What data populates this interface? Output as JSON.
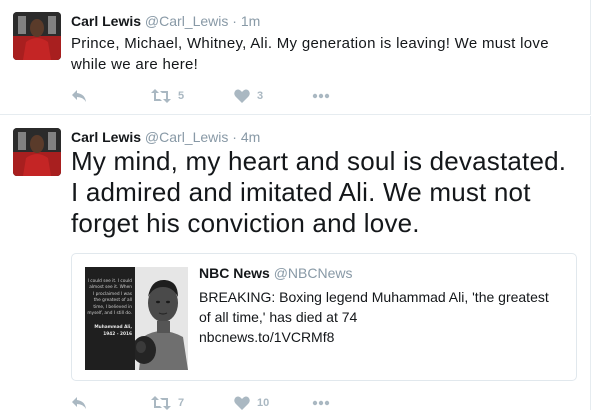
{
  "colors": {
    "text": "#14171a",
    "muted": "#8899a6",
    "action_icon": "#aab8c2",
    "border": "#e6ecf0"
  },
  "tweets": [
    {
      "author_name": "Carl Lewis",
      "author_handle": "@Carl_Lewis",
      "separator": "·",
      "time": "1m",
      "text": "Prince,  Michael,  Whitney, Ali.  My generation is leaving!  We must love while we are here!",
      "actions": {
        "reply_icon": "reply-icon",
        "retweet_icon": "retweet-icon",
        "retweet_count": "5",
        "like_icon": "heart-icon",
        "like_count": "3",
        "more_icon": "more-icon"
      }
    },
    {
      "author_name": "Carl Lewis",
      "author_handle": "@Carl_Lewis",
      "separator": "·",
      "time": "4m",
      "text": "My mind, my heart and soul is devastated. I admired and imitated Ali.  We must not forget his conviction and love.",
      "quoted": {
        "author_name": "NBC News",
        "author_handle": "@NBCNews",
        "text": "BREAKING: Boxing legend Muhammad Ali, 'the greatest of all time,' has died at 74",
        "link": "nbcnews.to/1VCRMf8",
        "image_quote": "I could see it. I could almost see it. When I proclaimed I was the greatest of all time, I believed in myself, and I still do.",
        "image_credit": "Muhammad Ali, 1942 - 2016"
      },
      "actions": {
        "reply_icon": "reply-icon",
        "retweet_icon": "retweet-icon",
        "retweet_count": "7",
        "like_icon": "heart-icon",
        "like_count": "10",
        "more_icon": "more-icon"
      }
    }
  ]
}
